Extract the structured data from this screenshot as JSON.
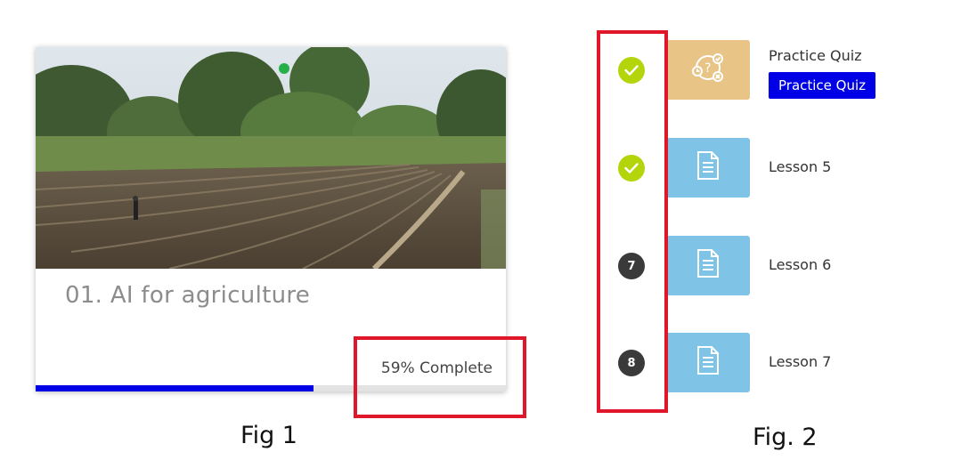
{
  "fig1": {
    "course_title": "01. AI for agriculture",
    "progress_text": "59% Complete",
    "progress_fraction": 0.59,
    "caption": "Fig 1"
  },
  "fig2": {
    "caption": "Fig. 2",
    "items": [
      {
        "status": "completed",
        "icon": "quiz-icon",
        "label": "Practice Quiz",
        "button_label": "Practice Quiz"
      },
      {
        "status": "completed",
        "icon": "document-icon",
        "label": "Lesson 5"
      },
      {
        "status": "number",
        "number": "7",
        "icon": "document-icon",
        "label": "Lesson 6"
      },
      {
        "status": "number",
        "number": "8",
        "icon": "document-icon",
        "label": "Lesson 7"
      }
    ]
  },
  "colors": {
    "highlight": "#e0162b",
    "progress_fill": "#0000e6",
    "completed_green": "#b4d40c",
    "quiz_tile": "#e8c486",
    "lesson_tile": "#7fc3e6"
  }
}
